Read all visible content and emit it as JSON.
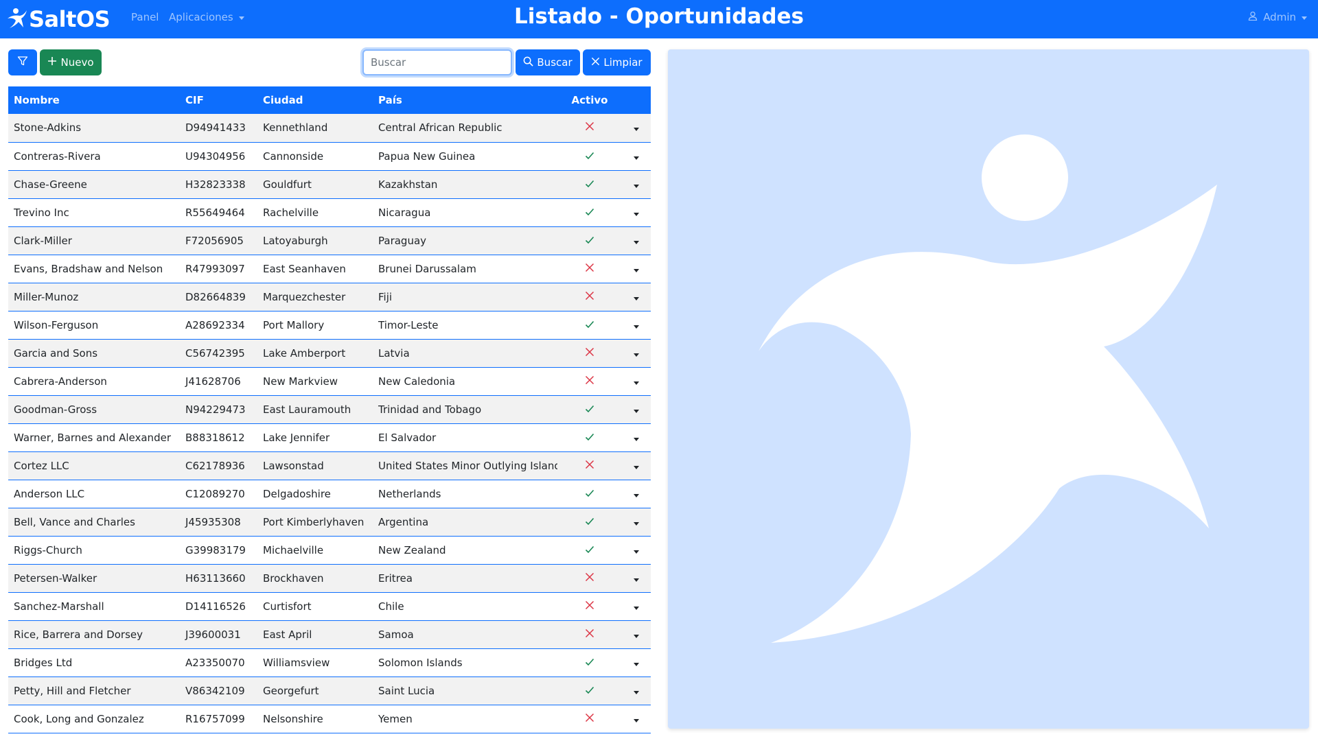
{
  "brand": {
    "name": "SaltOS"
  },
  "nav": {
    "panel": "Panel",
    "apps": "Aplicaciones",
    "user": "Admin"
  },
  "page": {
    "title": "Listado - Oportunidades"
  },
  "toolbar": {
    "new_label": "Nuevo",
    "search_placeholder": "Buscar",
    "search_value": "",
    "search_label": "Buscar",
    "clear_label": "Limpiar"
  },
  "table": {
    "columns": {
      "name": "Nombre",
      "cif": "CIF",
      "city": "Ciudad",
      "country": "País",
      "active": "Activo"
    },
    "rows": [
      {
        "name": "Stone-Adkins",
        "cif": "D94941433",
        "city": "Kennethland",
        "country": "Central African Republic",
        "active": false
      },
      {
        "name": "Contreras-Rivera",
        "cif": "U94304956",
        "city": "Cannonside",
        "country": "Papua New Guinea",
        "active": true
      },
      {
        "name": "Chase-Greene",
        "cif": "H32823338",
        "city": "Gouldfurt",
        "country": "Kazakhstan",
        "active": true
      },
      {
        "name": "Trevino Inc",
        "cif": "R55649464",
        "city": "Rachelville",
        "country": "Nicaragua",
        "active": true
      },
      {
        "name": "Clark-Miller",
        "cif": "F72056905",
        "city": "Latoyaburgh",
        "country": "Paraguay",
        "active": true
      },
      {
        "name": "Evans, Bradshaw and Nelson",
        "cif": "R47993097",
        "city": "East Seanhaven",
        "country": "Brunei Darussalam",
        "active": false
      },
      {
        "name": "Miller-Munoz",
        "cif": "D82664839",
        "city": "Marquezchester",
        "country": "Fiji",
        "active": false
      },
      {
        "name": "Wilson-Ferguson",
        "cif": "A28692334",
        "city": "Port Mallory",
        "country": "Timor-Leste",
        "active": true
      },
      {
        "name": "Garcia and Sons",
        "cif": "C56742395",
        "city": "Lake Amberport",
        "country": "Latvia",
        "active": false
      },
      {
        "name": "Cabrera-Anderson",
        "cif": "J41628706",
        "city": "New Markview",
        "country": "New Caledonia",
        "active": false
      },
      {
        "name": "Goodman-Gross",
        "cif": "N94229473",
        "city": "East Lauramouth",
        "country": "Trinidad and Tobago",
        "active": true
      },
      {
        "name": "Warner, Barnes and Alexander",
        "cif": "B88318612",
        "city": "Lake Jennifer",
        "country": "El Salvador",
        "active": true
      },
      {
        "name": "Cortez LLC",
        "cif": "C62178936",
        "city": "Lawsonstad",
        "country": "United States Minor Outlying Islands",
        "active": false
      },
      {
        "name": "Anderson LLC",
        "cif": "C12089270",
        "city": "Delgadoshire",
        "country": "Netherlands",
        "active": true
      },
      {
        "name": "Bell, Vance and Charles",
        "cif": "J45935308",
        "city": "Port Kimberlyhaven",
        "country": "Argentina",
        "active": true
      },
      {
        "name": "Riggs-Church",
        "cif": "G39983179",
        "city": "Michaelville",
        "country": "New Zealand",
        "active": true
      },
      {
        "name": "Petersen-Walker",
        "cif": "H63113660",
        "city": "Brockhaven",
        "country": "Eritrea",
        "active": false
      },
      {
        "name": "Sanchez-Marshall",
        "cif": "D14116526",
        "city": "Curtisfort",
        "country": "Chile",
        "active": false
      },
      {
        "name": "Rice, Barrera and Dorsey",
        "cif": "J39600031",
        "city": "East April",
        "country": "Samoa",
        "active": false
      },
      {
        "name": "Bridges Ltd",
        "cif": "A23350070",
        "city": "Williamsview",
        "country": "Solomon Islands",
        "active": true
      },
      {
        "name": "Petty, Hill and Fletcher",
        "cif": "V86342109",
        "city": "Georgefurt",
        "country": "Saint Lucia",
        "active": true
      },
      {
        "name": "Cook, Long and Gonzalez",
        "cif": "R16757099",
        "city": "Nelsonshire",
        "country": "Yemen",
        "active": false
      }
    ]
  },
  "icons": {
    "brand": "saltos-runner-icon",
    "caret": "caret-down-icon",
    "user": "user-icon",
    "filter": "funnel-icon",
    "add": "plus-icon",
    "search": "magnifier-icon",
    "clear": "x-icon",
    "active_true": "check-icon",
    "active_false": "x-icon"
  },
  "colors": {
    "primary": "#0d6efd",
    "success": "#198754",
    "danger": "#dc3545",
    "hero_bg": "#cfe2ff"
  }
}
